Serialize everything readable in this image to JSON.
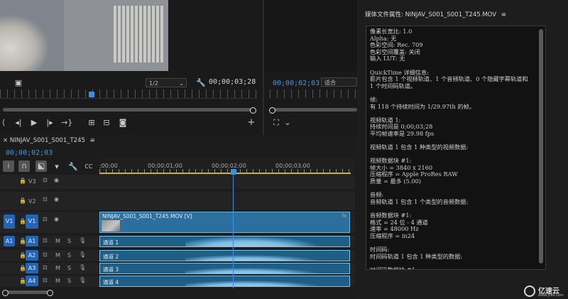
{
  "source_monitor": {
    "resolution": "1/2",
    "timecode": "00;00;03;28"
  },
  "program_monitor": {
    "timecode": "00;00;02;03",
    "fit": "适合"
  },
  "timeline": {
    "sequence_name": "NINJAV_S001_S001_T245",
    "current_time": "00;00;02;03",
    "ruler_labels": [
      ";00;00",
      "00;00;01;00",
      "00;00;02;00",
      "00;00;03;00"
    ],
    "video_tracks": [
      {
        "id": "V3",
        "target": ""
      },
      {
        "id": "V2",
        "target": ""
      },
      {
        "id": "V1",
        "target": "V1"
      }
    ],
    "audio_tracks": [
      {
        "id": "A1",
        "target": "A1",
        "mute": "M",
        "solo": "S",
        "clip": "通道 1"
      },
      {
        "id": "A2",
        "target": "",
        "mute": "M",
        "solo": "S",
        "clip": "通道 2"
      },
      {
        "id": "A3",
        "target": "",
        "mute": "M",
        "solo": "S",
        "clip": "通道 3"
      },
      {
        "id": "A4",
        "target": "",
        "mute": "M",
        "solo": "S",
        "clip": "通道 4"
      }
    ],
    "video_clip_name": "NINJAV_S001_S001_T245.MOV [V]",
    "fx_badge": "fx"
  },
  "media_info": {
    "title": "媒体文件属性: NINJAV_S001_S001_T245.MOV",
    "lines": [
      "像素长宽比: 1.0",
      "Alpha: 无",
      "色彩空间: Rec. 709",
      "色彩空间覆盖: 关闭",
      "输入 LUT: 无",
      "",
      "QuickTime 详细信息:",
      "影片包含 1 个视频轨道、1 个音频轨道、0 个隐藏字幕轨道和",
      "1 个时间码轨道。",
      "",
      "帧:",
      "有 118 个持续时间为 1/29.97th 的帧。",
      "",
      "视频轨道 1:",
      "持续时间是 0;00;03;28",
      "平均帧速率是 29.98 fps",
      "",
      "视频轨道 1 包含 1 种类型的视频数据:",
      "",
      "视频数据块 #1:",
      "帧大小 = 3840 x 2160",
      "压缩程序 = Apple ProRes RAW",
      "质量 = 最多 (5.00)",
      "",
      "音频:",
      "音频轨道 1 包含 1 个类型的音频数据:",
      "",
      "音频数据块 #1:",
      "格式 = 24 位 - 4 通道",
      "速率 = 48000 Hz",
      "压缩程序 = in24",
      "",
      "时间码:",
      "时间码轨道 1 包含 1 种类型的数据:",
      "",
      "时间码数据块 #1:",
      "开始时间 = 01;00;00;28",
      "卷名 ="
    ]
  },
  "watermark": {
    "text": "亿速云",
    "sub": "www.yisu.com"
  },
  "colors": {
    "accent": "#2f8fe0",
    "clip_video": "#2a6f9e",
    "clip_audio": "#1f5f86",
    "target_button": "#2464b4"
  }
}
